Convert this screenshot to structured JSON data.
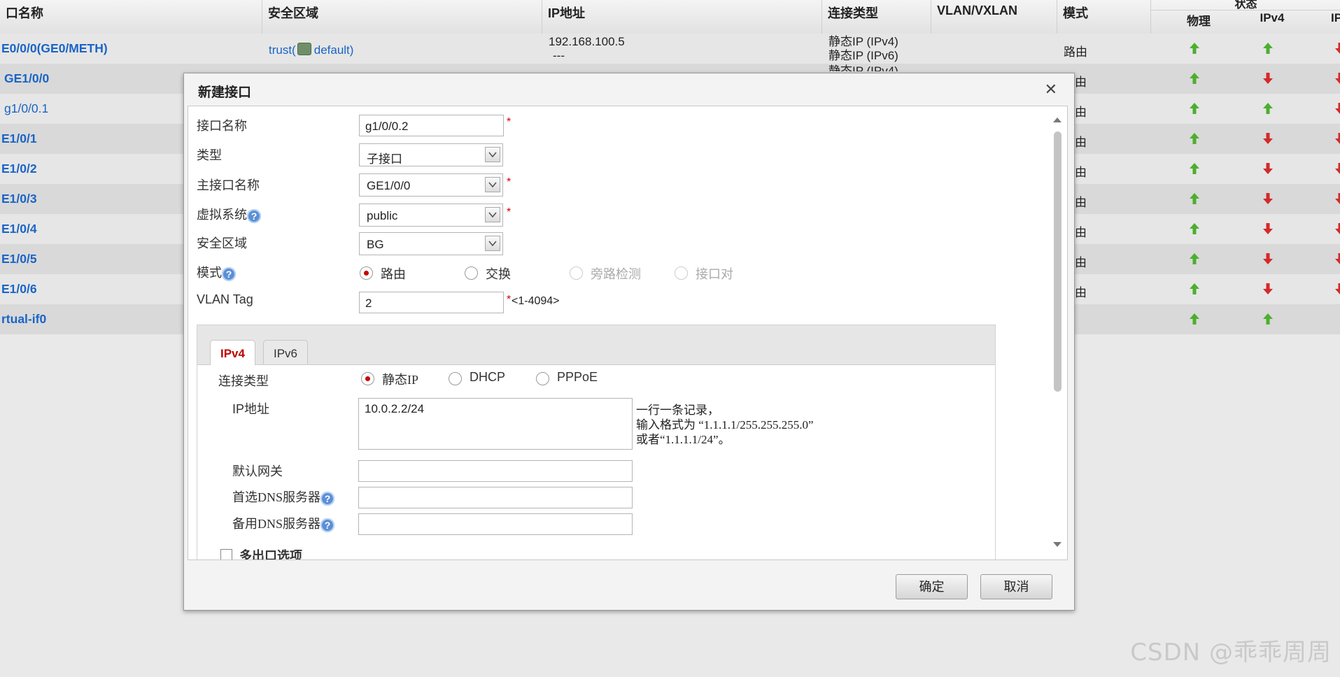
{
  "table": {
    "headers": {
      "name": "口名称",
      "zone": "安全区域",
      "ip": "IP地址",
      "conn_type": "连接类型",
      "vlan": "VLAN/VXLAN",
      "mode": "模式",
      "status": "状态",
      "status_phys": "物理",
      "status_ipv4": "IPv4",
      "status_ipv6": "IP"
    },
    "rows": [
      {
        "name": "E0/0/0(GE0/METH)",
        "zone_text": "trust(",
        "zone_vsys": "default)",
        "ip": "192.168.100.5",
        "ip2": "---",
        "conn1": "静态IP (IPv4)",
        "conn2": "静态IP (IPv6)",
        "mode": "路由",
        "phys": "up",
        "ipv4": "up",
        "ipv6": "down"
      },
      {
        "name": "GE1/0/0",
        "mode": "由",
        "phys": "up",
        "ipv4": "down",
        "ipv6": "down"
      },
      {
        "name": "g1/0/0.1",
        "mode": "由",
        "phys": "up",
        "ipv4": "up",
        "ipv6": "down"
      },
      {
        "name": "E1/0/1",
        "mode": "由",
        "phys": "up",
        "ipv4": "down",
        "ipv6": "down"
      },
      {
        "name": "E1/0/2",
        "mode": "由",
        "phys": "up",
        "ipv4": "down",
        "ipv6": "down"
      },
      {
        "name": "E1/0/3",
        "mode": "由",
        "phys": "up",
        "ipv4": "down",
        "ipv6": "down"
      },
      {
        "name": "E1/0/4",
        "mode": "由",
        "phys": "up",
        "ipv4": "down",
        "ipv6": "down"
      },
      {
        "name": "E1/0/5",
        "mode": "由",
        "phys": "up",
        "ipv4": "down",
        "ipv6": "down"
      },
      {
        "name": "E1/0/6",
        "mode": "由",
        "phys": "up",
        "ipv4": "down",
        "ipv6": "down"
      },
      {
        "name": "rtual-if0",
        "mode": "",
        "phys": "up",
        "ipv4": "up",
        "ipv6": ""
      }
    ],
    "partial_conn": "静态IP (IPv4)"
  },
  "dialog": {
    "title": "新建接口",
    "close": "✕",
    "fields": {
      "if_name_label": "接口名称",
      "if_name_value": "g1/0/0.2",
      "type_label": "类型",
      "type_value": "子接口",
      "parent_label": "主接口名称",
      "parent_value": "GE1/0/0",
      "vsys_label": "虚拟系统",
      "vsys_value": "public",
      "zone_label": "安全区域",
      "zone_value": "BG",
      "mode_label": "模式",
      "mode_options": [
        "路由",
        "交换",
        "旁路检测",
        "接口对"
      ],
      "vlan_label": "VLAN Tag",
      "vlan_value": "2",
      "vlan_range": "<1-4094>",
      "required_mark": "*",
      "help_mark": "?"
    },
    "ip_tabs": [
      "IPv4",
      "IPv6"
    ],
    "ipv4": {
      "conn_label": "连接类型",
      "conn_options": [
        "静态IP",
        "DHCP",
        "PPPoE"
      ],
      "ip_label": "IP地址",
      "ip_value": "10.0.2.2/24",
      "hint_1": "一行一条记录，",
      "hint_2": "输入格式为 “1.1.1.1/255.255.255.0”",
      "hint_3": "或者“1.1.1.1/24”。",
      "gw_label": "默认网关",
      "dns1_label": "首选DNS服务器",
      "dns2_label": "备用DNS服务器",
      "multi_label": "多出口选项"
    },
    "buttons": {
      "ok": "确定",
      "cancel": "取消"
    }
  },
  "watermark": "CSDN @乖乖周周",
  "colors": {
    "up": "#4caf2e",
    "down": "#d42a2a",
    "link": "#1a64c7",
    "required": "#d40000",
    "active_tab": "#c00000"
  }
}
